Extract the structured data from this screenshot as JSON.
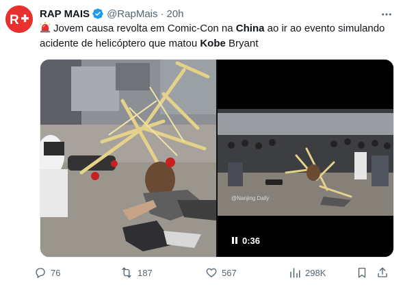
{
  "author": {
    "name": "RAP MAIS",
    "handle": "@RapMais",
    "separator": "·",
    "time": "20h",
    "avatar_text": "R+"
  },
  "tweet": {
    "text_1": "Jovem causa revolta em Comic-Con na ",
    "bold_1": "China",
    "text_2": " ao ir ao evento simulando acidente de helicóptero que matou ",
    "bold_2": "Kobe",
    "text_3": " Bryant"
  },
  "media": {
    "video_duration": "0:36",
    "watermark": "@Nanjing Daily"
  },
  "actions": {
    "replies": "76",
    "reposts": "187",
    "likes": "567",
    "views": "298K"
  },
  "colors": {
    "brand_red": "#e8302f",
    "verified_blue": "#1d9bf0",
    "muted": "#536471"
  }
}
